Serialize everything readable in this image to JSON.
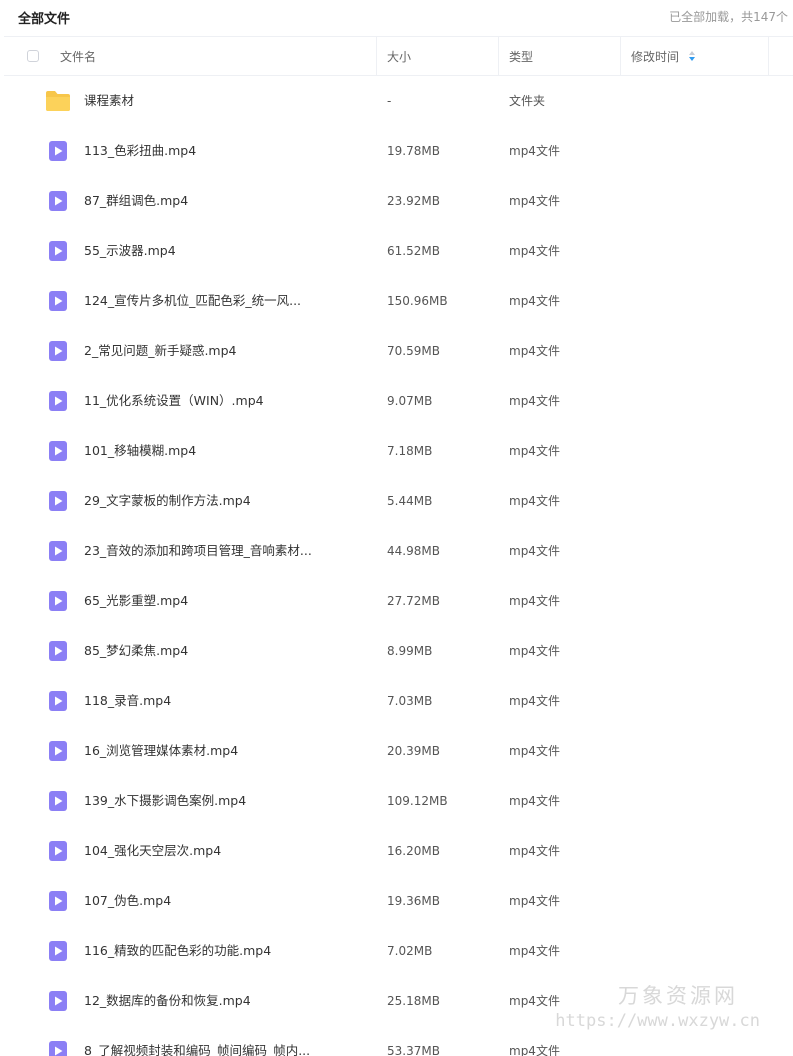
{
  "header": {
    "title": "全部文件",
    "status": "已全部加载，共147个"
  },
  "table": {
    "columns": {
      "name": "文件名",
      "size": "大小",
      "type": "类型",
      "modified": "修改时间"
    },
    "rows": [
      {
        "icon": "folder-icon",
        "name": "课程素材",
        "size": "-",
        "type": "文件夹"
      },
      {
        "icon": "video-file-icon",
        "name": "113_色彩扭曲.mp4",
        "size": "19.78MB",
        "type": "mp4文件"
      },
      {
        "icon": "video-file-icon",
        "name": "87_群组调色.mp4",
        "size": "23.92MB",
        "type": "mp4文件"
      },
      {
        "icon": "video-file-icon",
        "name": "55_示波器.mp4",
        "size": "61.52MB",
        "type": "mp4文件"
      },
      {
        "icon": "video-file-icon",
        "name": "124_宣传片多机位_匹配色彩_统一风...",
        "size": "150.96MB",
        "type": "mp4文件"
      },
      {
        "icon": "video-file-icon",
        "name": "2_常见问题_新手疑惑.mp4",
        "size": "70.59MB",
        "type": "mp4文件"
      },
      {
        "icon": "video-file-icon",
        "name": "11_优化系统设置（WIN）.mp4",
        "size": "9.07MB",
        "type": "mp4文件"
      },
      {
        "icon": "video-file-icon",
        "name": "101_移轴模糊.mp4",
        "size": "7.18MB",
        "type": "mp4文件"
      },
      {
        "icon": "video-file-icon",
        "name": "29_文字蒙板的制作方法.mp4",
        "size": "5.44MB",
        "type": "mp4文件"
      },
      {
        "icon": "video-file-icon",
        "name": "23_音效的添加和跨项目管理_音响素材...",
        "size": "44.98MB",
        "type": "mp4文件"
      },
      {
        "icon": "video-file-icon",
        "name": "65_光影重塑.mp4",
        "size": "27.72MB",
        "type": "mp4文件"
      },
      {
        "icon": "video-file-icon",
        "name": "85_梦幻柔焦.mp4",
        "size": "8.99MB",
        "type": "mp4文件"
      },
      {
        "icon": "video-file-icon",
        "name": "118_录音.mp4",
        "size": "7.03MB",
        "type": "mp4文件"
      },
      {
        "icon": "video-file-icon",
        "name": "16_浏览管理媒体素材.mp4",
        "size": "20.39MB",
        "type": "mp4文件"
      },
      {
        "icon": "video-file-icon",
        "name": "139_水下摄影调色案例.mp4",
        "size": "109.12MB",
        "type": "mp4文件"
      },
      {
        "icon": "video-file-icon",
        "name": "104_强化天空层次.mp4",
        "size": "16.20MB",
        "type": "mp4文件"
      },
      {
        "icon": "video-file-icon",
        "name": "107_伪色.mp4",
        "size": "19.36MB",
        "type": "mp4文件"
      },
      {
        "icon": "video-file-icon",
        "name": "116_精致的匹配色彩的功能.mp4",
        "size": "7.02MB",
        "type": "mp4文件"
      },
      {
        "icon": "video-file-icon",
        "name": "12_数据库的备份和恢复.mp4",
        "size": "25.18MB",
        "type": "mp4文件"
      },
      {
        "icon": "video-file-icon",
        "name": "8_了解视频封装和编码_帧间编码_帧内...",
        "size": "53.37MB",
        "type": "mp4文件"
      }
    ]
  },
  "watermark": {
    "title": "万象资源网",
    "url": "https://www.wxzyw.cn"
  },
  "colors": {
    "folder": "#f7c64a",
    "video_icon": "#8b7ff5",
    "sort_up": "#c8ccd4",
    "sort_down": "#2f9bf0"
  }
}
